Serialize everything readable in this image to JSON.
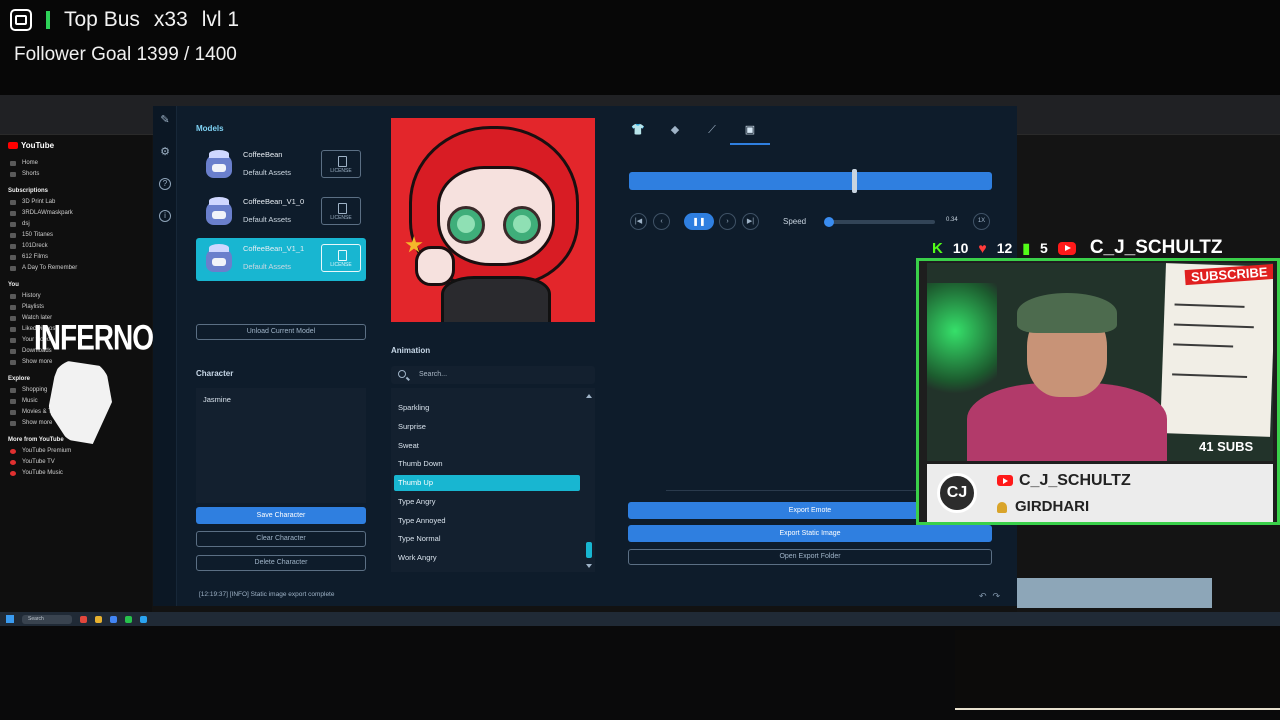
{
  "overlay": {
    "top_bus_label": "Top Bus",
    "top_bus_count": "x33",
    "top_bus_level": "lvl 1",
    "follower_goal": "Follower Goal 1399 / 1400"
  },
  "youtube_sidebar": {
    "logo": "YouTube",
    "items": [
      "Home",
      "Shorts"
    ],
    "subscriptions_heading": "Subscriptions",
    "subscriptions": [
      "3D Print Lab",
      "3RDLAWmaskpark",
      "dsj",
      "150 Titanes",
      "101Dreck",
      "612 Films",
      "A Day To Remember"
    ],
    "you_heading": "You",
    "you_items": [
      "History",
      "Playlists",
      "Watch later",
      "Liked videos",
      "Your videos",
      "Downloads",
      "Show more"
    ],
    "explore_heading": "Explore",
    "explore_items": [
      "Shopping",
      "Music",
      "Movies & TV",
      "Show more"
    ],
    "more_heading": "More from YouTube",
    "more_items": [
      "YouTube Premium",
      "YouTube TV",
      "YouTube Music"
    ],
    "inferno_label": "INFERNO"
  },
  "app": {
    "models_label": "Models",
    "models": [
      {
        "name": "CoffeeBean",
        "sub": "Default Assets",
        "license": "LICENSE"
      },
      {
        "name": "CoffeeBean_V1_0",
        "sub": "Default Assets",
        "license": "LICENSE"
      },
      {
        "name": "CoffeeBean_V1_1",
        "sub": "Default Assets",
        "license": "LICENSE"
      }
    ],
    "unload_button": "Unload Current Model",
    "character_label": "Character",
    "character_items": [
      "Jasmine"
    ],
    "save_character": "Save Character",
    "clear_character": "Clear Character",
    "delete_character": "Delete Character",
    "animation_label": "Animation",
    "search_placeholder": "Search...",
    "animations": [
      "Sparkling",
      "Surprise",
      "Sweat",
      "Thumb Down",
      "Thumb Up",
      "Type Angry",
      "Type Annoyed",
      "Type Normal",
      "Work Angry"
    ],
    "active_animation": "Thumb Up",
    "timeline_progress": 0.62,
    "speed_label": "Speed",
    "speed_value": "0.34",
    "speed_fraction": 0.0,
    "speed_multiplier": "1X",
    "export_emote": "Export Emote",
    "export_static": "Export Static Image",
    "open_export": "Open Export Folder",
    "status": "[12:19:37] [INFO] Static image export complete"
  },
  "taskbar": {
    "search": "Search"
  },
  "webcam": {
    "kick_count": "10",
    "heart_count": "12",
    "bars_count": "5",
    "channel_top": "C_J_SCHULTZ",
    "subscribe_text": "SUBSCRIBE",
    "subs_count": "41 SUBS",
    "plate_name": "C_J_SCHULTZ",
    "plate_user": "GIRDHARI",
    "logo_text": "CJ"
  }
}
